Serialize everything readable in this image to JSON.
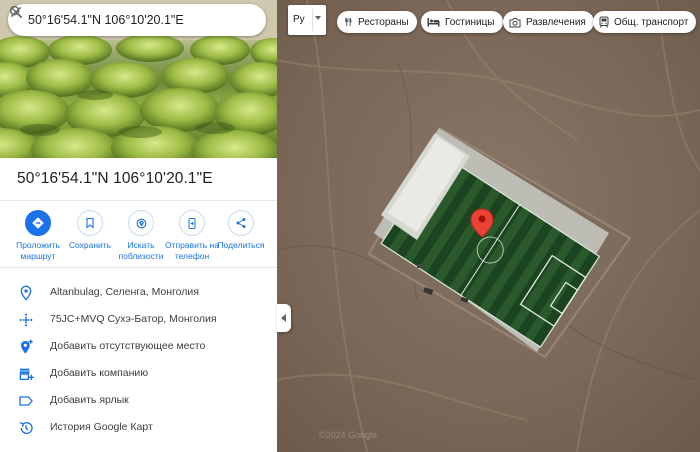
{
  "search": {
    "value": "50°16'54.1\"N 106°10'20.1\"E"
  },
  "place": {
    "title": "50°16'54.1\"N 106°10'20.1\"E"
  },
  "actions": [
    {
      "label": "Проложить маршрут",
      "icon": "directions-icon"
    },
    {
      "label": "Сохранить",
      "icon": "bookmark-icon"
    },
    {
      "label": "Искать поблизости",
      "icon": "nearby-icon"
    },
    {
      "label": "Отправить на телефон",
      "icon": "send-to-phone-icon"
    },
    {
      "label": "Поделиться",
      "icon": "share-icon"
    }
  ],
  "details": [
    {
      "text": "Altanbulag, Селенга, Монголия",
      "icon": "location-pin-icon"
    },
    {
      "text": "75JC+MVQ Сухэ-Батор, Монголия",
      "icon": "plus-code-icon"
    },
    {
      "text": "Добавить отсутствующее место",
      "icon": "add-place-icon"
    },
    {
      "text": "Добавить компанию",
      "icon": "add-business-icon"
    },
    {
      "text": "Добавить ярлык",
      "icon": "label-icon"
    },
    {
      "text": "История Google Карт",
      "icon": "history-icon"
    }
  ],
  "map": {
    "layer_label": "Ру",
    "chips": [
      {
        "label": "Рестораны",
        "icon": "restaurant-icon"
      },
      {
        "label": "Гостиницы",
        "icon": "hotel-icon"
      },
      {
        "label": "Развлечения",
        "icon": "camera-icon"
      },
      {
        "label": "Общ. транспорт",
        "icon": "transit-icon"
      }
    ]
  },
  "colors": {
    "accent": "#1a73e8",
    "marker": "#ea4335",
    "field": "#1f4a22"
  }
}
